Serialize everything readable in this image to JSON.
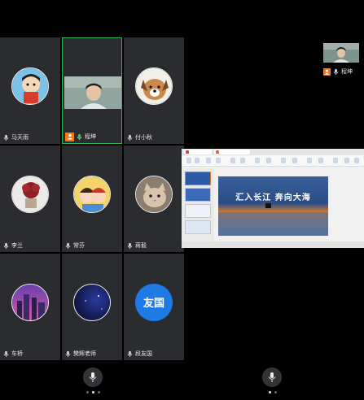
{
  "participants": [
    {
      "name": "马天雨",
      "avatar": "cartoon-boy-avatar"
    },
    {
      "name": "程坤",
      "avatar": "camera-video",
      "host": true
    },
    {
      "name": "付小秋",
      "avatar": "dog-avatar"
    },
    {
      "name": "李兰",
      "avatar": "red-flower-avatar"
    },
    {
      "name": "常芬",
      "avatar": "cartoon-kids-avatar"
    },
    {
      "name": "蒋毅",
      "avatar": "cat-avatar"
    },
    {
      "name": "车桥",
      "avatar": "city-night-avatar"
    },
    {
      "name": "樊辉老师",
      "avatar": "night-sky-avatar"
    },
    {
      "name": "段友国",
      "avatar": "text-avatar",
      "avatar_text": "友国"
    }
  ],
  "self_view": {
    "name": "程坤"
  },
  "shared_screen": {
    "slide_title": "汇入长江  奔向大海"
  },
  "colors": {
    "active_border": "#2fb35a",
    "host_badge": "#f07a1a",
    "text_avatar_bg": "#1e7be6"
  }
}
